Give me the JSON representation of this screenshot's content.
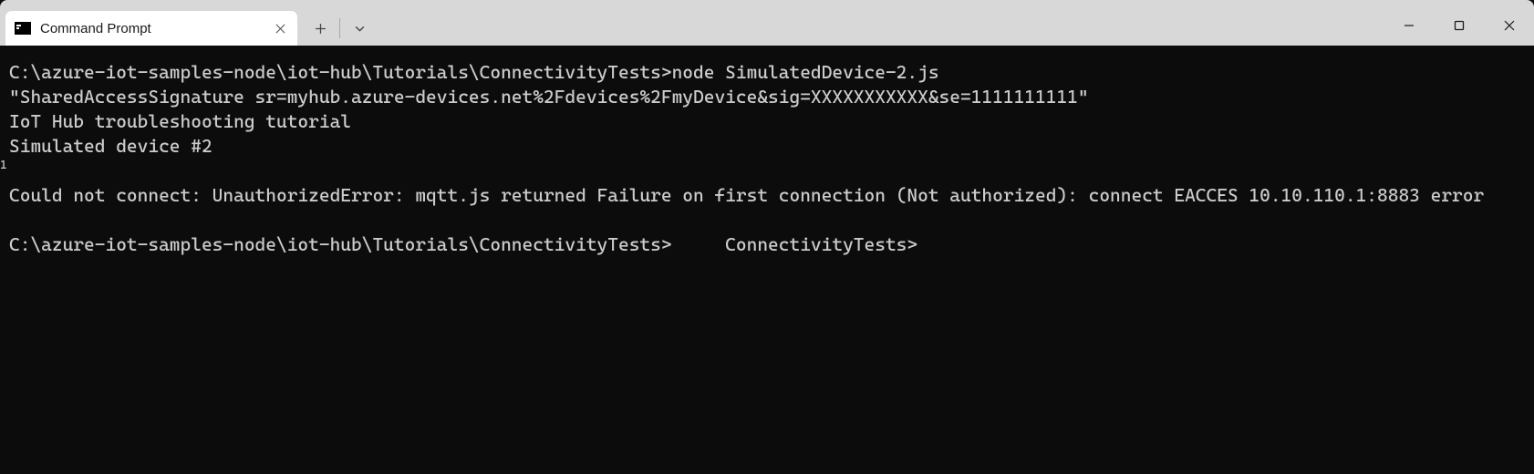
{
  "window": {
    "tab_title": "Command Prompt",
    "page_indicator": "1"
  },
  "terminal": {
    "lines": [
      "C:\\azure-iot-samples-node\\iot-hub\\Tutorials\\ConnectivityTests>node SimulatedDevice-2.js",
      "\"SharedAccessSignature sr=myhub.azure-devices.net%2Fdevices%2FmyDevice&sig=XXXXXXXXXXX&se=1111111111\"",
      "IoT Hub troubleshooting tutorial",
      "Simulated device #2",
      "",
      "Could not connect: UnauthorizedError: mqtt.js returned Failure on first connection (Not authorized): connect EACCES 10.10.110.1:8883 error",
      "",
      "C:\\azure-iot-samples-node\\iot-hub\\Tutorials\\ConnectivityTests>     ConnectivityTests>"
    ]
  }
}
